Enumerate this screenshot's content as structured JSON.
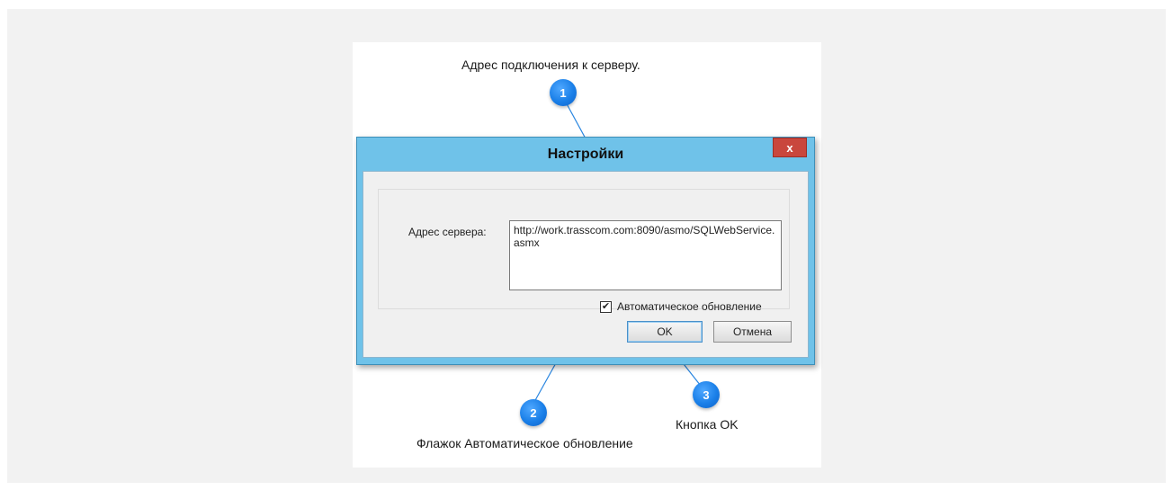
{
  "captions": {
    "top": "Адрес подключения к серверу.",
    "bottom_left": "Флажок Автоматическое обновление",
    "bottom_right": "Кнопка OK"
  },
  "markers": [
    "1",
    "2",
    "3"
  ],
  "dialog": {
    "title": "Настройки",
    "close_label": "x",
    "address_label": "Адрес сервера:",
    "address_value": "http://work.trasscom.com:8090/asmo/SQLWebService.asmx",
    "auto_update_label": "Автоматическое обновление",
    "auto_update_checked": true,
    "ok_label": "OK",
    "cancel_label": "Отмена"
  },
  "colors": {
    "marker": "#1a7fe8",
    "callout_line": "#2a86e0",
    "dialog_frame": "#6fc2e9",
    "close_button": "#c9473d"
  },
  "icons": {
    "checkbox": "check-mark"
  }
}
